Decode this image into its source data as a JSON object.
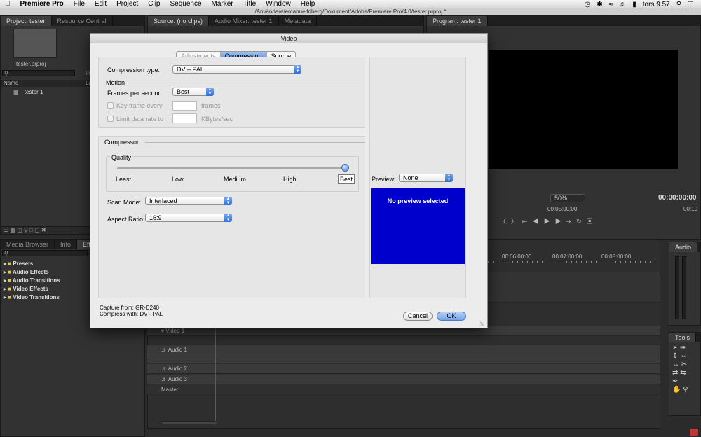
{
  "menubar": {
    "apple": "",
    "app": "Premiere Pro",
    "items": [
      "File",
      "Edit",
      "Project",
      "Clip",
      "Sequence",
      "Marker",
      "Title",
      "Window",
      "Help"
    ],
    "clock": "tors 9.57"
  },
  "window_title": "/Användare/emanuelfriberg/Dokument/Adobe/Premiere Pro/4.0/tester.prproj *",
  "project_panel": {
    "tabs": [
      "Project: tester",
      "Resource Central"
    ],
    "filename": "tester.prproj",
    "columns": [
      "Name",
      "La"
    ],
    "items": [
      "tester 1"
    ],
    "partial_label": "In"
  },
  "source_panel": {
    "tabs": [
      "Source: (no clips)",
      "Audio Mixer: tester 1",
      "Metadata"
    ]
  },
  "program_panel": {
    "tab": "Program: tester 1",
    "zoom": "50%",
    "timecode": "00:00:00:00",
    "ruler_marks": [
      "00:05:00:00",
      "00:10"
    ]
  },
  "effects_panel": {
    "tabs": [
      "Media Browser",
      "Info",
      "Effects"
    ],
    "folders": [
      "Presets",
      "Audio Effects",
      "Audio Transitions",
      "Video Effects",
      "Video Transitions"
    ]
  },
  "timeline": {
    "ruler": [
      "00:06:00:00",
      "00:07:00:00",
      "00:08:00:00"
    ],
    "tracks": [
      "Video 1",
      "Audio 1",
      "Audio 2",
      "Audio 3",
      "Master"
    ]
  },
  "audio_meter": {
    "label": "Audio"
  },
  "tools_panel": {
    "label": "Tools"
  },
  "dialog": {
    "title": "Video",
    "tabs": [
      "Adjustments",
      "Compression",
      "Source"
    ],
    "compression_type_label": "Compression type:",
    "compression_type_value": "DV – PAL",
    "motion_label": "Motion",
    "fps_label": "Frames per second:",
    "fps_value": "Best",
    "keyframe_label": "Key frame every",
    "keyframe_unit": "frames",
    "limit_label": "Limit data rate to",
    "limit_unit": "KBytes/sec",
    "compressor_label": "Compressor",
    "quality_label": "Quality",
    "quality_marks": [
      "Least",
      "Low",
      "Medium",
      "High",
      "Best"
    ],
    "quality_level": 1.0,
    "scan_mode_label": "Scan Mode:",
    "scan_mode_value": "Interlaced",
    "aspect_label": "Aspect Ratio:",
    "aspect_value": "16:9",
    "preview_label": "Preview:",
    "preview_value": "None",
    "preview_message": "No preview selected",
    "capture_from": "Capture from: GR-D240",
    "compress_with": "Compress with: DV - PAL",
    "cancel": "Cancel",
    "ok": "OK",
    "colors": {
      "preview_bg": "#0000cc",
      "accent": "#5d8fd6"
    }
  }
}
